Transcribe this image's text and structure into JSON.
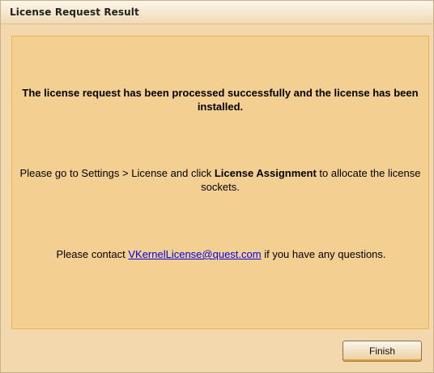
{
  "dialog": {
    "title": "License Request Result"
  },
  "content": {
    "success_message": "The license request has been processed successfully and the license has been installed.",
    "settings_prefix": "Please go to Settings > License and click ",
    "settings_bold": "License Assignment",
    "settings_suffix": " to allocate the license sockets.",
    "contact_prefix": "Please contact ",
    "contact_email": "VKernelLicense@quest.com",
    "contact_suffix": " if you have any questions."
  },
  "footer": {
    "finish_label": "Finish"
  }
}
